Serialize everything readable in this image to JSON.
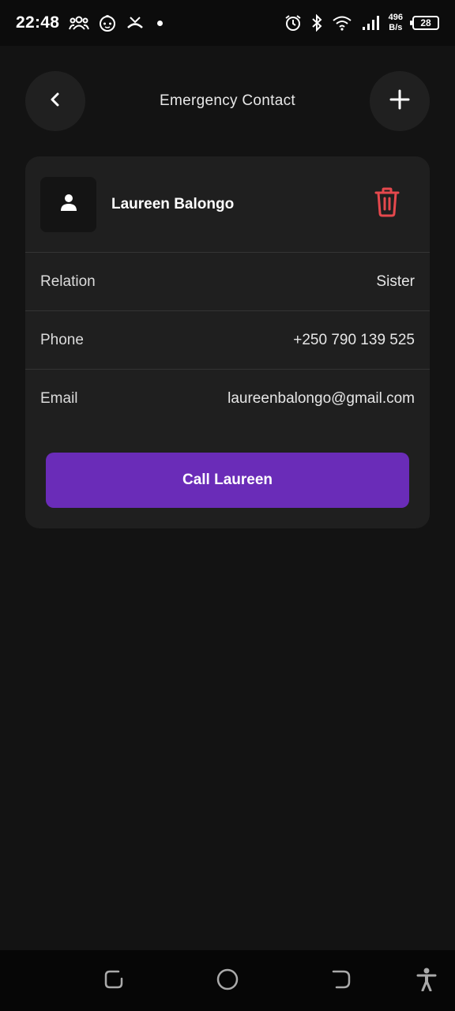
{
  "status_bar": {
    "time": "22:48",
    "net_speed_value": "496",
    "net_speed_unit": "B/s",
    "battery": "28",
    "icons": [
      "group-icon",
      "face-icon",
      "missed-call-icon",
      "dot-icon",
      "alarm-icon",
      "bluetooth-icon",
      "wifi-icon",
      "signal-icon",
      "battery-icon"
    ]
  },
  "header": {
    "title": "Emergency Contact",
    "back_icon": "chevron-left-icon",
    "add_icon": "plus-icon"
  },
  "contact": {
    "name": "Laureen Balongo",
    "avatar_icon": "person-icon",
    "delete_icon": "trash-icon",
    "delete_color": "#e5484d",
    "rows": [
      {
        "label": "Relation",
        "value": "Sister"
      },
      {
        "label": "Phone",
        "value": "+250 790 139 525"
      },
      {
        "label": "Email",
        "value": "laureenbalongo@gmail.com"
      }
    ],
    "call_button": "Call Laureen",
    "call_button_color": "#6a2cb8"
  },
  "nav_bar": {
    "icons": [
      "recents-icon",
      "home-icon",
      "back-icon",
      "accessibility-icon"
    ]
  }
}
